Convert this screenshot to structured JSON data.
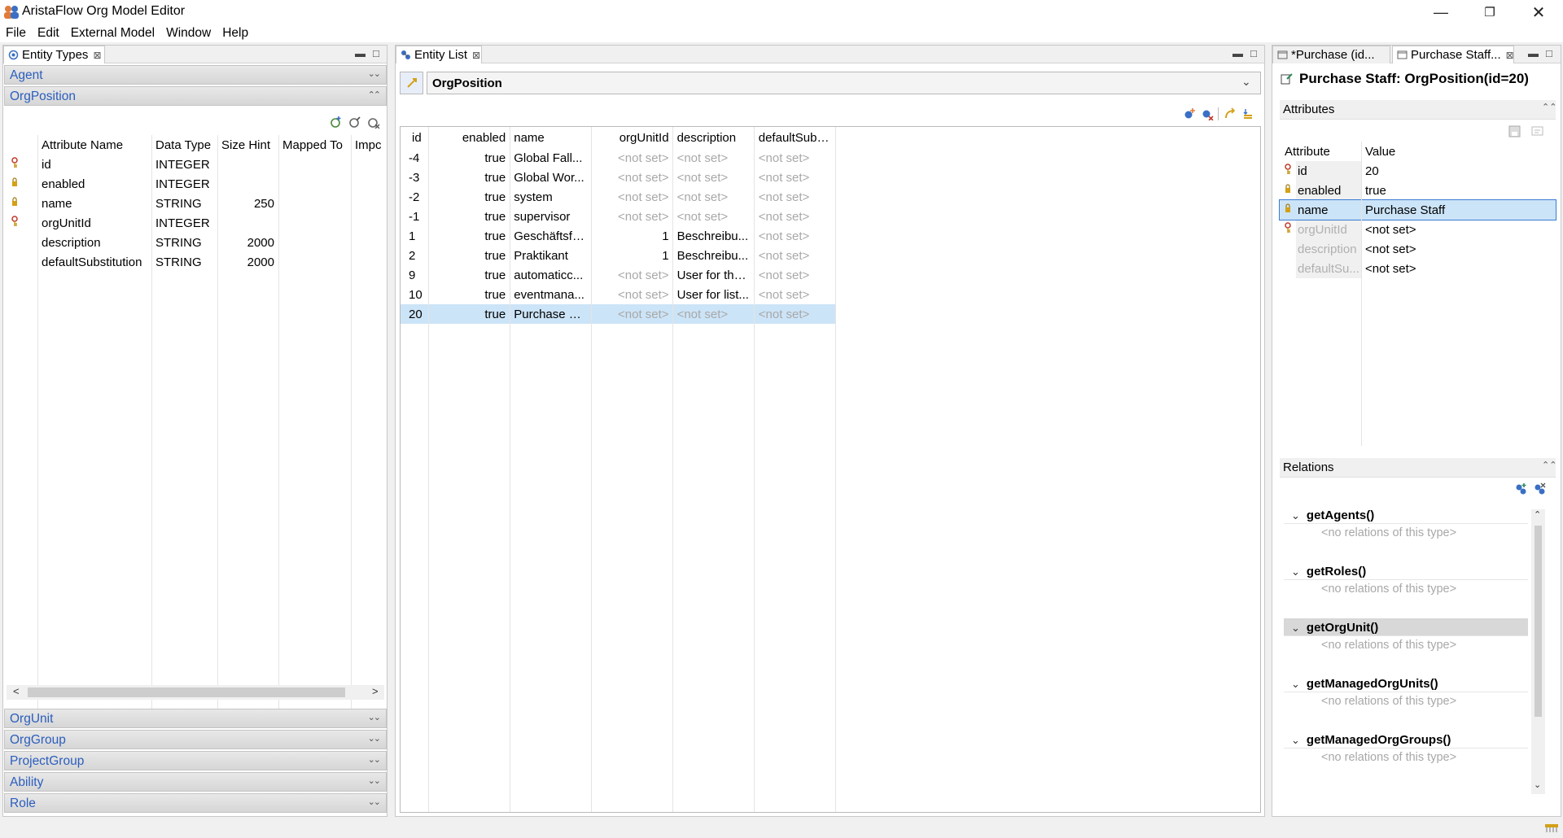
{
  "window": {
    "title": "AristaFlow Org Model Editor"
  },
  "menu": [
    "File",
    "Edit",
    "External Model",
    "Window",
    "Help"
  ],
  "entity_types": {
    "tab_label": "Entity Types",
    "sections_top": [
      "Agent",
      "OrgPosition"
    ],
    "columns": [
      "Attribute Name",
      "Data Type",
      "Size Hint",
      "Mapped To",
      "Impc"
    ],
    "rows": [
      {
        "key": "primary",
        "name": "id",
        "type": "INTEGER",
        "size": ""
      },
      {
        "key": "lock",
        "name": "enabled",
        "type": "INTEGER",
        "size": ""
      },
      {
        "key": "lock",
        "name": "name",
        "type": "STRING",
        "size": "250"
      },
      {
        "key": "primary",
        "name": "orgUnitId",
        "type": "INTEGER",
        "size": ""
      },
      {
        "key": "",
        "name": "description",
        "type": "STRING",
        "size": "2000"
      },
      {
        "key": "",
        "name": "defaultSubstitution",
        "type": "STRING",
        "size": "2000"
      }
    ],
    "sections_bottom": [
      "OrgUnit",
      "OrgGroup",
      "ProjectGroup",
      "Ability",
      "Role"
    ]
  },
  "entity_list": {
    "tab_label": "Entity List",
    "combo_value": "OrgPosition",
    "columns": [
      "id",
      "enabled",
      "name",
      "orgUnitId",
      "description",
      "defaultSubs..."
    ],
    "rows": [
      [
        "-4",
        "true",
        "Global Fall...",
        "<not set>",
        "<not set>",
        "<not set>"
      ],
      [
        "-3",
        "true",
        "Global Wor...",
        "<not set>",
        "<not set>",
        "<not set>"
      ],
      [
        "-2",
        "true",
        "system",
        "<not set>",
        "<not set>",
        "<not set>"
      ],
      [
        "-1",
        "true",
        "supervisor",
        "<not set>",
        "<not set>",
        "<not set>"
      ],
      [
        "1",
        "true",
        "Geschäftsfü...",
        "1",
        "Beschreibu...",
        "<not set>"
      ],
      [
        "2",
        "true",
        "Praktikant",
        "1",
        "Beschreibu...",
        "<not set>"
      ],
      [
        "9",
        "true",
        "automaticc...",
        "<not set>",
        "User for the...",
        "<not set>"
      ],
      [
        "10",
        "true",
        "eventmana...",
        "<not set>",
        "User for list...",
        "<not set>"
      ],
      [
        "20",
        "true",
        "Purchase St...",
        "<not set>",
        "<not set>",
        "<not set>"
      ]
    ],
    "selected_row": 8
  },
  "editor": {
    "tabs": [
      "*Purchase (id...",
      "Purchase Staff..."
    ],
    "heading": "Purchase Staff: OrgPosition(id=20)",
    "attributes_label": "Attributes",
    "attr_columns": [
      "Attribute",
      "Value"
    ],
    "attributes": [
      {
        "key": "primary",
        "name": "id",
        "value": "20",
        "disabled": false
      },
      {
        "key": "lock",
        "name": "enabled",
        "value": "true",
        "disabled": false
      },
      {
        "key": "lock",
        "name": "name",
        "value": "Purchase Staff",
        "disabled": false
      },
      {
        "key": "primary",
        "name": "orgUnitId",
        "value": "<not set>",
        "disabled": true
      },
      {
        "key": "",
        "name": "description",
        "value": "<not set>",
        "disabled": true
      },
      {
        "key": "",
        "name": "defaultSu...",
        "value": "<not set>",
        "disabled": true
      }
    ],
    "relations_label": "Relations",
    "relations": [
      {
        "name": "getAgents()",
        "empty": "<no relations of this type>"
      },
      {
        "name": "getRoles()",
        "empty": "<no relations of this type>"
      },
      {
        "name": "getOrgUnit()",
        "empty": "<no relations of this type>"
      },
      {
        "name": "getManagedOrgUnits()",
        "empty": "<no relations of this type>"
      },
      {
        "name": "getManagedOrgGroups()",
        "empty": "<no relations of this type>"
      }
    ]
  }
}
